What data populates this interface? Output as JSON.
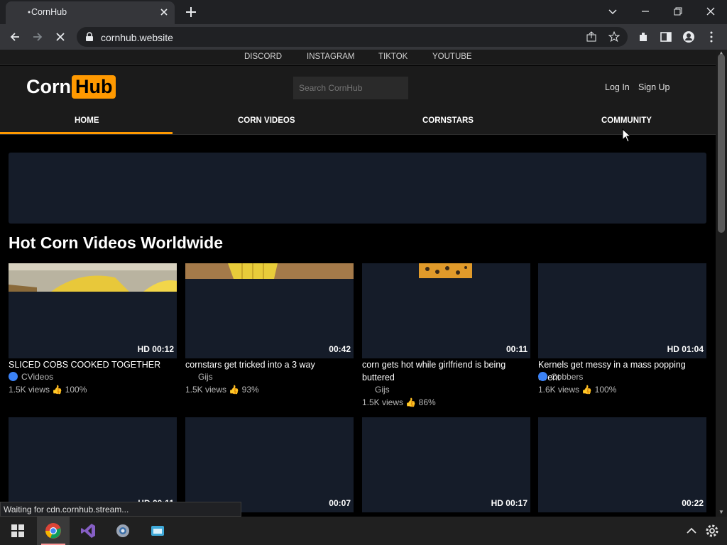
{
  "browser": {
    "tab_title": "CornHub",
    "url": "cornhub.website",
    "status": "Waiting for cdn.cornhub.stream..."
  },
  "social_links": [
    "DISCORD",
    "INSTAGRAM",
    "TIKTOK",
    "YOUTUBE"
  ],
  "header": {
    "logo_left": "Corn",
    "logo_right": "Hub",
    "search_placeholder": "Search CornHub",
    "login": "Log In",
    "signup": "Sign Up"
  },
  "nav": [
    "HOME",
    "CORN VIDEOS",
    "CORNSTARS",
    "COMMUNITY"
  ],
  "main": {
    "heading": "Hot Corn Videos Worldwide"
  },
  "videos": [
    {
      "title": "SLICED COBS COOKED TOGETHER",
      "duration": "HD 00:12",
      "channel": "CVideos",
      "verified": true,
      "views": "1.5K views",
      "rating": "100%"
    },
    {
      "title": "cornstars get tricked into a 3 way",
      "duration": "00:42",
      "channel": "Gijs",
      "verified": false,
      "views": "1.5K views",
      "rating": "93%"
    },
    {
      "title": "corn gets hot while girlfriend is being buttered",
      "duration": "00:11",
      "channel": "Gijs",
      "verified": false,
      "views": "1.5K views",
      "rating": "86%"
    },
    {
      "title": "Kernels get messy in a mass popping event",
      "duration": "HD 01:04",
      "channel": "Cobbers",
      "verified": true,
      "views": "1.6K views",
      "rating": "100%"
    },
    {
      "title": "",
      "duration": "HD 00:11",
      "channel": "",
      "verified": false,
      "views": "",
      "rating": ""
    },
    {
      "title": "",
      "duration": "00:07",
      "channel": "",
      "verified": false,
      "views": "",
      "rating": ""
    },
    {
      "title": "",
      "duration": "HD 00:17",
      "channel": "",
      "verified": false,
      "views": "",
      "rating": ""
    },
    {
      "title": "",
      "duration": "00:22",
      "channel": "",
      "verified": false,
      "views": "",
      "rating": ""
    }
  ],
  "colors": {
    "accent": "#ff9900",
    "card_bg": "#151c29",
    "verified": "#3b82f6"
  }
}
